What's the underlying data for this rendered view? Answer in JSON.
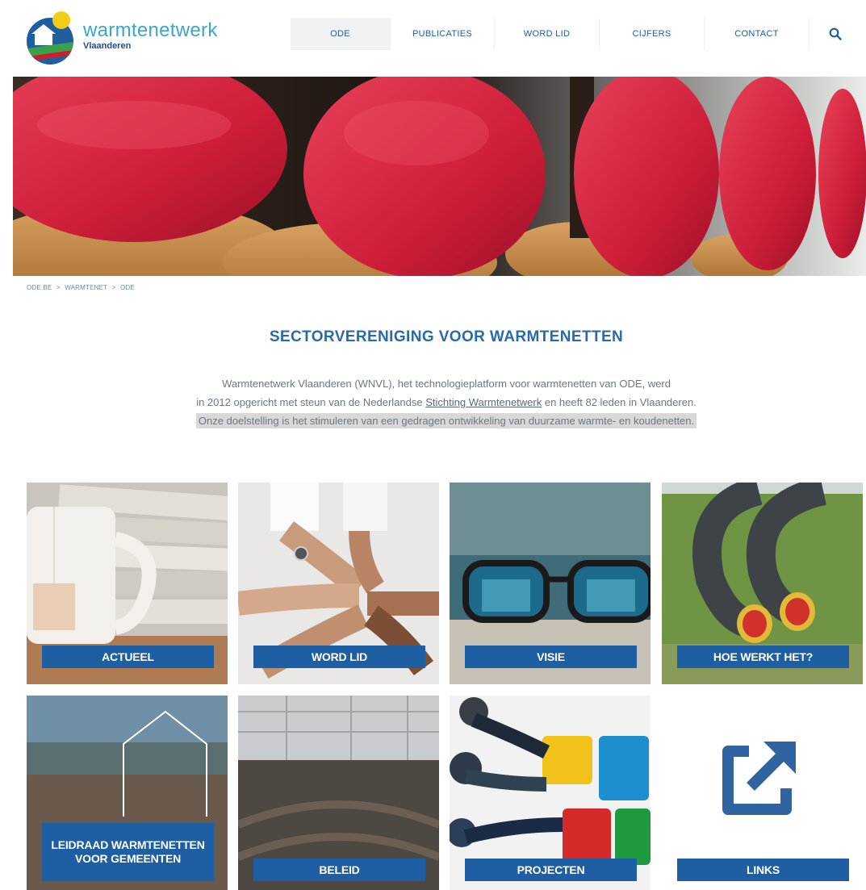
{
  "header": {
    "logo_name": "warmtenetwerk",
    "logo_region": "Vlaanderen",
    "nav": [
      {
        "label": "ODE",
        "active": true
      },
      {
        "label": "PUBLICATIES",
        "active": false
      },
      {
        "label": "WORD LID",
        "active": false
      },
      {
        "label": "CIJFERS",
        "active": false
      },
      {
        "label": "CONTACT",
        "active": false
      }
    ],
    "search_icon": "search-icon"
  },
  "breadcrumb": [
    "ODE.BE",
    ">",
    "WARMTENET",
    ">",
    "ODE"
  ],
  "main": {
    "title": "SECTORVERENIGING VOOR WARMTENETTEN",
    "intro_line1": "Warmtenetwerk Vlaanderen (WNVL), het technologieplatform voor warmtenetten van ODE, werd",
    "intro_line2_before": "in 2012 opgericht met steun van de Nederlandse ",
    "intro_link": "Stichting Warmtenetwerk",
    "intro_line2_after": " en heeft 82 leden in Vlaanderen.",
    "intro_line3": "Onze doelstelling is het stimuleren van een gedragen ontwikkeling van duurzame warmte- en koudenetten."
  },
  "tiles": [
    {
      "label": "ACTUEEL"
    },
    {
      "label": "WORD LID"
    },
    {
      "label": "VISIE"
    },
    {
      "label": "HOE WERKT HET?"
    },
    {
      "label": "LEIDRAAD WARMTENETTEN VOOR GEMEENTEN"
    },
    {
      "label": "BELEID"
    },
    {
      "label": "PROJECTEN"
    },
    {
      "label": "LINKS",
      "icon": "external-link-icon"
    }
  ],
  "colors": {
    "brand_blue": "#1e5ea3",
    "title_blue": "#2a6aa8",
    "logo_teal": "#3ba6c9",
    "sun_yellow": "#f3cc16"
  }
}
